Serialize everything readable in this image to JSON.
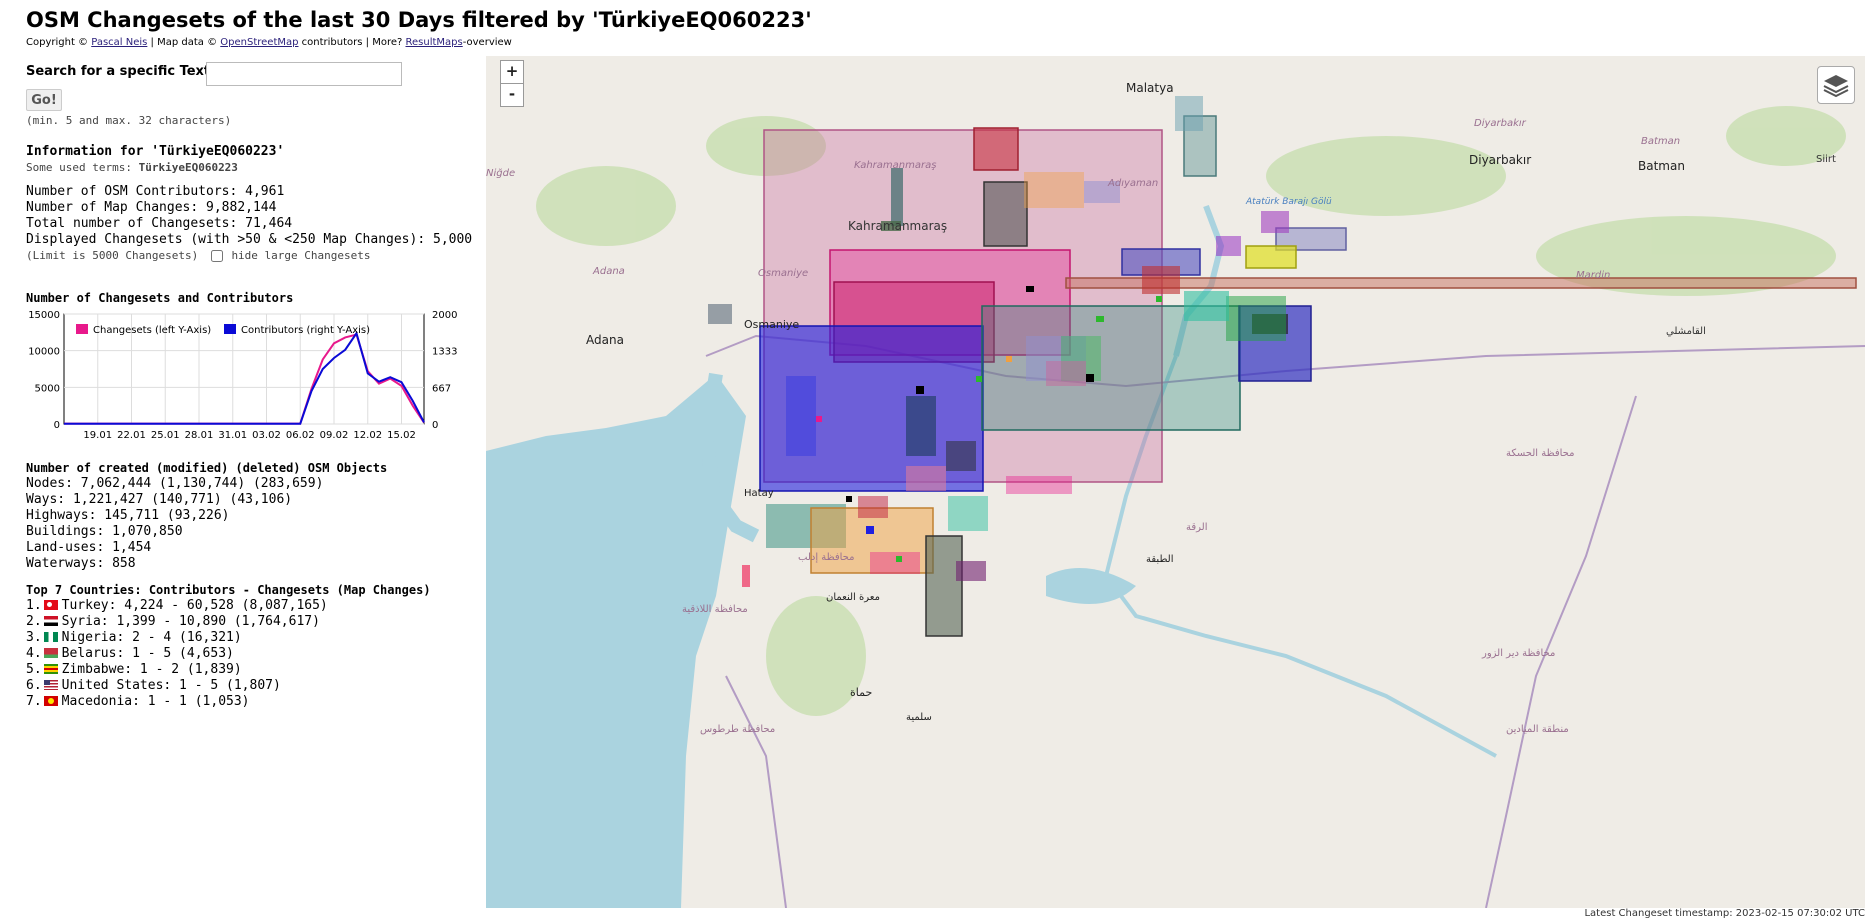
{
  "header": {
    "title": "OSM Changesets of the last 30 Days filtered by 'TürkiyeEQ060223'",
    "copyright_prefix": "Copyright ©",
    "author_link": "Pascal Neis",
    "map_data_prefix": "| Map data ©",
    "osm_link": "OpenStreetMap",
    "contributors_text": "contributors | More?",
    "resultmaps_link": "ResultMaps",
    "overview_suffix": "-overview"
  },
  "search": {
    "label": "Search for a specific Text:",
    "value": "",
    "button_label": "Go!",
    "hint": "(min. 5 and max. 32 characters)"
  },
  "info": {
    "heading": "Information for 'TürkiyeEQ060223'",
    "used_terms_label": "Some used terms:",
    "used_terms_value": "TürkiyeEQ060223",
    "contributors": "Number of OSM Contributors: 4,961",
    "map_changes": "Number of Map Changes: 9,882,144",
    "changesets": "Total number of Changesets: 71,464",
    "displayed": "Displayed Changesets (with >50 & <250 Map Changes): 5,000",
    "limit_note": "(Limit is 5000 Changesets)",
    "hide_large_label": "hide large Changesets"
  },
  "chart_section": {
    "heading": "Number of Changesets and Contributors"
  },
  "chart_data": {
    "type": "line",
    "x": [
      "16.01",
      "17.01",
      "18.01",
      "19.01",
      "20.01",
      "21.01",
      "22.01",
      "23.01",
      "24.01",
      "25.01",
      "26.01",
      "27.01",
      "28.01",
      "29.01",
      "30.01",
      "31.01",
      "01.02",
      "02.02",
      "03.02",
      "04.02",
      "05.02",
      "06.02",
      "07.02",
      "08.02",
      "09.02",
      "10.02",
      "11.02",
      "12.02",
      "13.02",
      "14.02",
      "15.02"
    ],
    "x_tick_labels": [
      "19.01",
      "22.01",
      "25.01",
      "28.01",
      "31.01",
      "03.02",
      "06.02",
      "09.02",
      "12.02",
      "15.02"
    ],
    "y_left_ticks": [
      "0",
      "5000",
      "10000",
      "15000"
    ],
    "y_right_ticks": [
      "0",
      "667",
      "1333",
      "2000"
    ],
    "ylim_left": [
      0,
      15000
    ],
    "ylim_right": [
      0,
      2000
    ],
    "legend_position": "top-left",
    "series": [
      {
        "name": "Changesets (left Y-Axis)",
        "axis": "left",
        "color": "#e8198b",
        "values": [
          50,
          50,
          50,
          50,
          50,
          50,
          50,
          50,
          50,
          50,
          50,
          50,
          50,
          50,
          50,
          50,
          50,
          50,
          50,
          50,
          50,
          50,
          4800,
          8800,
          11000,
          11800,
          12200,
          7200,
          5500,
          6200,
          5200,
          2500,
          200
        ]
      },
      {
        "name": "Contributors (right Y-Axis)",
        "axis": "right",
        "color": "#0a0ad6",
        "values": [
          5,
          5,
          5,
          5,
          5,
          5,
          5,
          5,
          5,
          5,
          5,
          5,
          5,
          5,
          5,
          5,
          5,
          5,
          5,
          5,
          5,
          5,
          600,
          1000,
          1200,
          1350,
          1650,
          920,
          770,
          850,
          760,
          420,
          30
        ]
      }
    ]
  },
  "objects": {
    "heading": "Number of created (modified) (deleted) OSM Objects",
    "nodes": "Nodes: 7,062,444 (1,130,744) (283,659)",
    "ways": "Ways: 1,221,427 (140,771) (43,106)",
    "highways": "Highways: 145,711 (93,226)",
    "buildings": "Buildings: 1,070,850",
    "landuses": "Land-uses: 1,454",
    "waterways": "Waterways: 858"
  },
  "countries": {
    "heading": "Top 7 Countries: Contributors - Changesets (Map Changes)",
    "items": [
      {
        "rank": "1.",
        "text": "Turkey: 4,224 - 60,528 (8,087,165)",
        "flag": "flag-turkey"
      },
      {
        "rank": "2.",
        "text": "Syria: 1,399 - 10,890 (1,764,617)",
        "flag": "flag-syria"
      },
      {
        "rank": "3.",
        "text": "Nigeria: 2 - 4 (16,321)",
        "flag": "flag-nigeria"
      },
      {
        "rank": "4.",
        "text": "Belarus: 1 - 5 (4,653)",
        "flag": "flag-belarus"
      },
      {
        "rank": "5.",
        "text": "Zimbabwe: 1 - 2 (1,839)",
        "flag": "flag-zimbabwe"
      },
      {
        "rank": "6.",
        "text": "United States: 1 - 5 (1,807)",
        "flag": "flag-usa"
      },
      {
        "rank": "7.",
        "text": "Macedonia: 1 - 1 (1,053)",
        "flag": "flag-macedonia"
      }
    ]
  },
  "map": {
    "zoom_in": "+",
    "zoom_out": "-",
    "labels": {
      "malatya": "Malatya",
      "kahramanmaras": "Kahramanmaraş",
      "kahramanmaras_big": "Kahramanmaraş",
      "adiyaman": "Adıyaman",
      "diyarbakir_region": "Diyarbakır",
      "diyarbakir": "Diyarbakır",
      "batman_region": "Batman",
      "batman": "Batman",
      "siirt": "Siirt",
      "adana_region": "Adana",
      "adana": "Adana",
      "osmaniye_region": "Osmaniye",
      "osmaniye": "Osmaniye",
      "nigde": "Niğde",
      "mardin": "Mardin",
      "hatay": "Hatay",
      "ataturk_dam": "Atatürk Barajı Gölü",
      "qamishli": "القامشلي",
      "raqqa": "الرقة",
      "hasakah": "محافظة الحسكة",
      "idlib": "محافظة إدلب",
      "maarrat": "معرة النعمان",
      "hama": "حماة",
      "salamiyah": "سلمية",
      "latakia": "محافظة اللاذقية",
      "tartus": "محافظة طرطوس",
      "deir_ez_zor": "محافظة دير الزور",
      "tabqa": "الطبقة",
      "mayadin": "منطقة الميادين"
    },
    "colors": {
      "pink": "#e8198b",
      "blue": "#2020e0",
      "teal": "#2a8a7a",
      "green": "#2db82d",
      "orange": "#f0a040"
    }
  },
  "footer": {
    "timestamp": "Latest Changeset timestamp: 2023-02-15 07:30:02 UTC"
  }
}
